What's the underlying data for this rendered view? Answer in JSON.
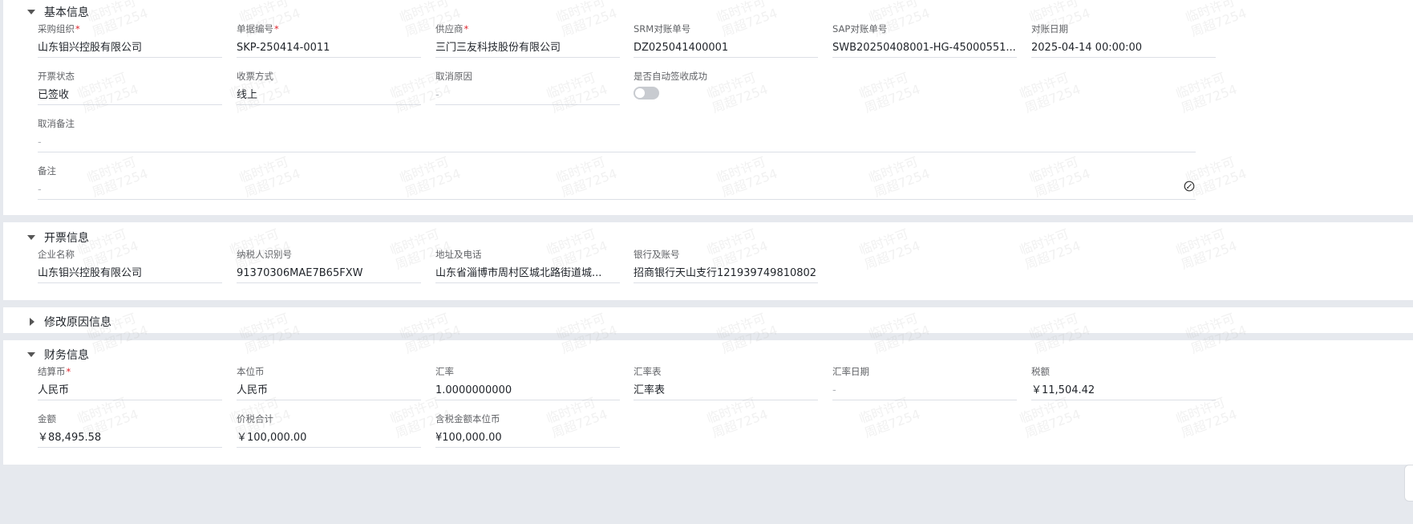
{
  "sections": {
    "basic": {
      "title": "基本信息",
      "fields": {
        "purchase_org": {
          "label": "采购组织",
          "value": "山东钼兴控股有限公司"
        },
        "doc_no": {
          "label": "单据编号",
          "value": "SKP-250414-0011"
        },
        "supplier": {
          "label": "供应商",
          "value": "三门三友科技股份有限公司"
        },
        "srm_no": {
          "label": "SRM对账单号",
          "value": "DZ025041400001"
        },
        "sap_no": {
          "label": "SAP对账单号",
          "value": "SWB20250408001-HG-45000551..."
        },
        "recon_date": {
          "label": "对账日期",
          "value": "2025-04-14 00:00:00"
        },
        "invoice_status": {
          "label": "开票状态",
          "value": "已签收"
        },
        "receipt_method": {
          "label": "收票方式",
          "value": "线上"
        },
        "cancel_reason": {
          "label": "取消原因",
          "value": "-"
        },
        "auto_sign": {
          "label": "是否自动签收成功"
        },
        "cancel_remark": {
          "label": "取消备注",
          "value": "-"
        },
        "remark": {
          "label": "备注",
          "value": "-"
        }
      }
    },
    "invoice": {
      "title": "开票信息",
      "fields": {
        "company": {
          "label": "企业名称",
          "value": "山东钼兴控股有限公司"
        },
        "tax_id": {
          "label": "纳税人识别号",
          "value": "91370306MAE7B65FXW"
        },
        "address": {
          "label": "地址及电话",
          "value": "山东省淄博市周村区城北路街道城..."
        },
        "bank": {
          "label": "银行及账号",
          "value": "招商银行天山支行121939749810802"
        }
      }
    },
    "modify": {
      "title": "修改原因信息"
    },
    "finance": {
      "title": "财务信息",
      "fields": {
        "currency": {
          "label": "结算币",
          "value": "人民币"
        },
        "local_currency": {
          "label": "本位币",
          "value": "人民币"
        },
        "rate": {
          "label": "汇率",
          "value": "1.0000000000"
        },
        "rate_table": {
          "label": "汇率表",
          "value": "汇率表"
        },
        "rate_date": {
          "label": "汇率日期",
          "value": "-"
        },
        "tax": {
          "label": "税额",
          "value": "￥11,504.42"
        },
        "amount": {
          "label": "金额",
          "value": "￥88,495.58"
        },
        "total": {
          "label": "价税合计",
          "value": "￥100,000.00"
        },
        "total_local": {
          "label": "含税金额本位币",
          "value": "¥100,000.00"
        }
      }
    }
  },
  "watermark": {
    "line1": "临时许可",
    "line2": "周超7254"
  },
  "colors": {
    "required": "#e0242c",
    "divider": "#dcdfe6",
    "background": "#e6e9ee"
  }
}
